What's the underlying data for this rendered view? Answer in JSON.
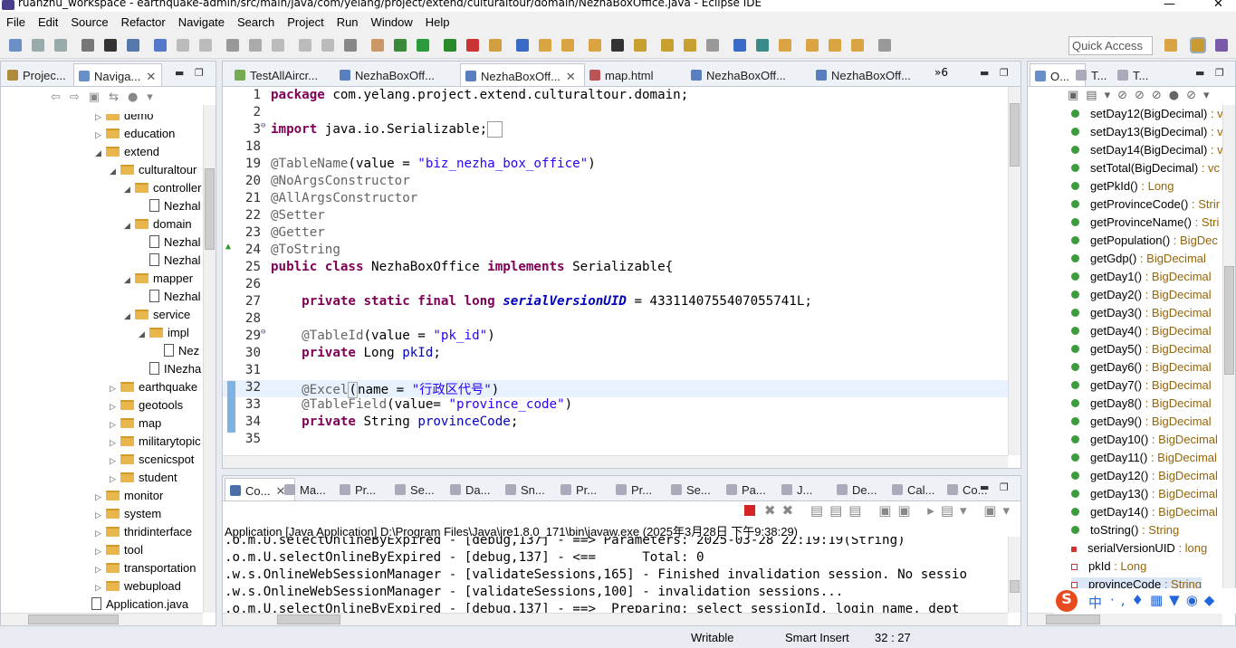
{
  "window": {
    "title": "ruanzhu_workspace - earthquake-admin/src/main/java/com/yelang/project/extend/culturaltour/domain/NezhaBoxOffice.java - Eclipse IDE",
    "minimize": "—",
    "close": "✕"
  },
  "menu": [
    "File",
    "Edit",
    "Source",
    "Refactor",
    "Navigate",
    "Search",
    "Project",
    "Run",
    "Window",
    "Help"
  ],
  "quick_access": "Quick Access",
  "left_panel": {
    "tabs": [
      "Projec...",
      "Naviga..."
    ],
    "tree": [
      {
        "label": "demo",
        "indent": 0
      },
      {
        "label": "education",
        "indent": 0
      },
      {
        "label": "extend",
        "indent": 0,
        "open": true
      },
      {
        "label": "culturaltour",
        "indent": 1,
        "open": true
      },
      {
        "label": "controller",
        "indent": 2,
        "open": true
      },
      {
        "label": "Nezhal",
        "indent": 3,
        "file": true
      },
      {
        "label": "domain",
        "indent": 2,
        "open": true
      },
      {
        "label": "Nezhal",
        "indent": 3,
        "file": true
      },
      {
        "label": "Nezhal",
        "indent": 3,
        "file": true
      },
      {
        "label": "mapper",
        "indent": 2,
        "open": true
      },
      {
        "label": "Nezhal",
        "indent": 3,
        "file": true
      },
      {
        "label": "service",
        "indent": 2,
        "open": true
      },
      {
        "label": "impl",
        "indent": 3,
        "open": true
      },
      {
        "label": "Nez",
        "indent": 4,
        "file": true
      },
      {
        "label": "INezha",
        "indent": 3,
        "file": true
      },
      {
        "label": "earthquake",
        "indent": 1
      },
      {
        "label": "geotools",
        "indent": 1
      },
      {
        "label": "map",
        "indent": 1
      },
      {
        "label": "militarytopic",
        "indent": 1
      },
      {
        "label": "scenicspot",
        "indent": 1
      },
      {
        "label": "student",
        "indent": 1
      },
      {
        "label": "monitor",
        "indent": 0
      },
      {
        "label": "system",
        "indent": 0
      },
      {
        "label": "thridinterface",
        "indent": 0
      },
      {
        "label": "tool",
        "indent": 0
      },
      {
        "label": "transportation",
        "indent": 0
      },
      {
        "label": "webupload",
        "indent": 0
      },
      {
        "label": "Application.java",
        "indent": -1,
        "file": true
      }
    ]
  },
  "editor": {
    "tabs": [
      "TestAllAircr...",
      "NezhaBoxOff...",
      "NezhaBoxOff...",
      "map.html",
      "NezhaBoxOff...",
      "NezhaBoxOff..."
    ],
    "overflow": "»6",
    "lines": [
      {
        "n": "1",
        "html": "<span class='kw'>package</span> com.yelang.project.extend.culturaltour.domain;"
      },
      {
        "n": "2",
        "html": ""
      },
      {
        "n": "3",
        "html": "<span class='kw'>import</span> java.io.Serializable;<span style='border:1px solid #999;padding:0 3px'> </span>"
      },
      {
        "n": "18",
        "html": ""
      },
      {
        "n": "19",
        "html": "<span class='an'>@TableName</span>(value = <span class='str'>\"biz_nezha_box_office\"</span>)"
      },
      {
        "n": "20",
        "html": "<span class='an'>@NoArgsConstructor</span>"
      },
      {
        "n": "21",
        "html": "<span class='an'>@AllArgsConstructor</span>"
      },
      {
        "n": "22",
        "html": "<span class='an'>@Setter</span>"
      },
      {
        "n": "23",
        "html": "<span class='an'>@Getter</span>"
      },
      {
        "n": "24",
        "html": "<span class='an'>@ToString</span>"
      },
      {
        "n": "25",
        "html": "<span class='kw'>public class</span> NezhaBoxOffice <span class='kw'>implements</span> Serializable{"
      },
      {
        "n": "26",
        "html": ""
      },
      {
        "n": "27",
        "html": "    <span class='kw'>private static final long</span> <span class='fldi'>serialVersionUID</span> = 4331140755407055741L;"
      },
      {
        "n": "28",
        "html": ""
      },
      {
        "n": "29",
        "html": "    <span class='an'>@TableId</span>(value = <span class='str'>\"pk_id\"</span>)"
      },
      {
        "n": "30",
        "html": "    <span class='kw'>private</span> Long <span class='fld'>pkId</span>;"
      },
      {
        "n": "31",
        "html": ""
      },
      {
        "n": "32",
        "html": "    <span class='an'>@Excel</span><span style='border:1px solid #aaa'>(</span>name = <span class='str'>\"行政区代号\"</span>)"
      },
      {
        "n": "33",
        "html": "    <span class='an'>@TableField</span>(value= <span class='str'>\"province_code\"</span>)"
      },
      {
        "n": "34",
        "html": "    <span class='kw'>private</span> String <span class='fld'>provinceCode</span>;"
      },
      {
        "n": "35",
        "html": ""
      }
    ]
  },
  "console": {
    "tabs": [
      "Co...",
      "Ma...",
      "Pr...",
      "Se...",
      "Da...",
      "Sn...",
      "Pr...",
      "Pr...",
      "Se...",
      "Pa...",
      "J...",
      "De...",
      "Cal...",
      "Co..."
    ],
    "header": "Application [Java Application] D:\\Program Files\\Java\\jre1.8.0_171\\bin\\javaw.exe (2025年3月28日 下午9:38:29)",
    "lines": [
      ".o.m.U.selectOnlineByExpired - [debug,137] - ==> Parameters: 2025-03-28 22:19:19(String)",
      ".o.m.U.selectOnlineByExpired - [debug,137] - <==      Total: 0",
      ".w.s.OnlineWebSessionManager - [validateSessions,165] - Finished invalidation session. No sessio",
      ".w.s.OnlineWebSessionManager - [validateSessions,100] - invalidation sessions...",
      ".o.m.U.selectOnlineByExpired - [debug,137] - ==>  Preparing: select sessionId, login_name, dept"
    ]
  },
  "outline": {
    "tabs": [
      "O...",
      "T...",
      "T..."
    ],
    "items": [
      {
        "name": "setDay12(BigDecimal)",
        "ret": " : v"
      },
      {
        "name": "setDay13(BigDecimal)",
        "ret": " : v"
      },
      {
        "name": "setDay14(BigDecimal)",
        "ret": " : v"
      },
      {
        "name": "setTotal(BigDecimal)",
        "ret": " : vc"
      },
      {
        "name": "getPkId()",
        "ret": " : Long"
      },
      {
        "name": "getProvinceCode()",
        "ret": " : Strir"
      },
      {
        "name": "getProvinceName()",
        "ret": " : Stri"
      },
      {
        "name": "getPopulation()",
        "ret": " : BigDec"
      },
      {
        "name": "getGdp()",
        "ret": " : BigDecimal"
      },
      {
        "name": "getDay1()",
        "ret": " : BigDecimal"
      },
      {
        "name": "getDay2()",
        "ret": " : BigDecimal"
      },
      {
        "name": "getDay3()",
        "ret": " : BigDecimal"
      },
      {
        "name": "getDay4()",
        "ret": " : BigDecimal"
      },
      {
        "name": "getDay5()",
        "ret": " : BigDecimal"
      },
      {
        "name": "getDay6()",
        "ret": " : BigDecimal"
      },
      {
        "name": "getDay7()",
        "ret": " : BigDecimal"
      },
      {
        "name": "getDay8()",
        "ret": " : BigDecimal"
      },
      {
        "name": "getDay9()",
        "ret": " : BigDecimal"
      },
      {
        "name": "getDay10()",
        "ret": " : BigDecimal"
      },
      {
        "name": "getDay11()",
        "ret": " : BigDecimal"
      },
      {
        "name": "getDay12()",
        "ret": " : BigDecimal"
      },
      {
        "name": "getDay13()",
        "ret": " : BigDecimal"
      },
      {
        "name": "getDay14()",
        "ret": " : BigDecimal"
      },
      {
        "name": "toString()",
        "ret": " : String"
      },
      {
        "name": "serialVersionUID",
        "ret": " : long"
      },
      {
        "name": "pkId",
        "ret": " : Long"
      },
      {
        "name": "provinceCode",
        "ret": " : String"
      }
    ]
  },
  "ime": {
    "label": "中"
  },
  "status": {
    "mode": "Writable",
    "insert": "Smart Insert",
    "position": "32 : 27"
  }
}
